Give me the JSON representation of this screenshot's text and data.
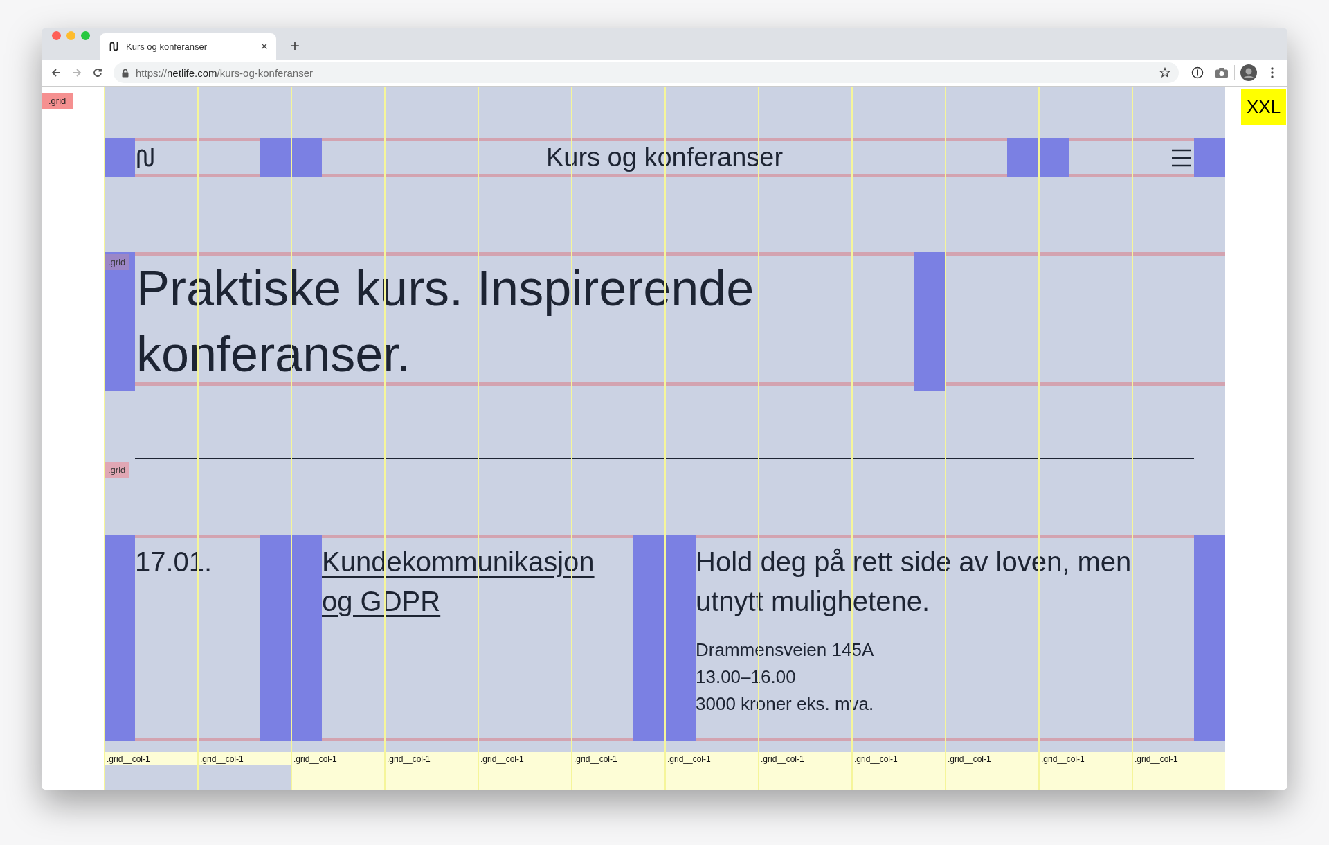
{
  "browser": {
    "tabs": [
      {
        "title": "Kurs og konferanser",
        "close": "×",
        "selected": true
      }
    ],
    "new_tab": "+",
    "forward": {
      "disabled": true
    },
    "address": {
      "scheme": "https://",
      "host": "netlife.com",
      "path": "/kurs-og-konferanser"
    }
  },
  "debug": {
    "grid_label": ".grid",
    "breakpoint": "XXL",
    "column_labels": [
      ".grid__col-1",
      ".grid__col-1",
      ".grid__col-1",
      ".grid__col-1",
      ".grid__col-1",
      ".grid__col-1",
      ".grid__col-1",
      ".grid__col-1",
      ".grid__col-1",
      ".grid__col-1",
      ".grid__col-1",
      ".grid__col-1"
    ]
  },
  "header": {
    "title": "Kurs og konferanser"
  },
  "hero": {
    "grid_label": ".grid",
    "heading": "Praktiske kurs. Inspirerende konferanser."
  },
  "section": {
    "grid_label": ".grid"
  },
  "events": [
    {
      "date": "17.01.",
      "title": "Kundekommunikasjon og GDPR",
      "summary": "Hold deg på rett side av loven, men utnytt mulighetene.",
      "address": "Drammensveien 145A",
      "time": "13.00–16.00",
      "price": "3000 kroner eks. mva."
    }
  ]
}
